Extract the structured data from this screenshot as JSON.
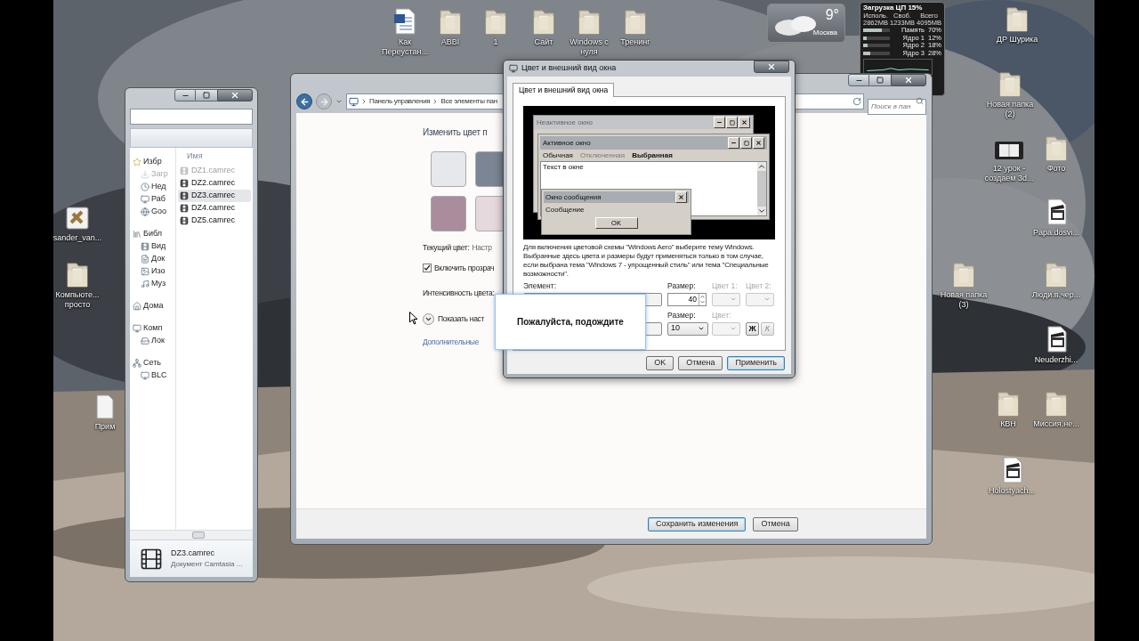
{
  "desktop_icons": [
    {
      "label": "Как Переустан...",
      "kind": "word"
    },
    {
      "label": "ABBI",
      "kind": "folder"
    },
    {
      "label": "1",
      "kind": "folder"
    },
    {
      "label": "Сайт",
      "kind": "folder"
    },
    {
      "label": "Windows с нуля",
      "kind": "folder"
    },
    {
      "label": "Тренинг",
      "kind": "folder"
    },
    {
      "label": "sander_van...",
      "kind": "app"
    },
    {
      "label": "Компьюте... просто",
      "kind": "folder"
    },
    {
      "label": "Прим",
      "kind": "page"
    },
    {
      "label": "ДР Шурика",
      "kind": "folder"
    },
    {
      "label": "Новая папка (2)",
      "kind": "folder"
    },
    {
      "label": "12 урок - создаем 3d...",
      "kind": "tablet"
    },
    {
      "label": "Фото",
      "kind": "folder"
    },
    {
      "label": "Papa.dosvi...",
      "kind": "video"
    },
    {
      "label": "Новая папка (3)",
      "kind": "folder"
    },
    {
      "label": "Люди.в.чер...",
      "kind": "folder"
    },
    {
      "label": "Neuderzhi...",
      "kind": "video"
    },
    {
      "label": "КВН",
      "kind": "folder"
    },
    {
      "label": "Миссия.не...",
      "kind": "folder"
    },
    {
      "label": "Holostyach...",
      "kind": "video"
    }
  ],
  "weather_gadget": {
    "temperature": "9°",
    "city": "Москва"
  },
  "cpu_gadget": {
    "title": "Загрузка ЦП 15%",
    "columns": [
      {
        "label": "Исполь.",
        "value": "2862MB"
      },
      {
        "label": "Своб.",
        "value": "1233MB"
      },
      {
        "label": "Всего",
        "value": "4095MB"
      }
    ],
    "meters": [
      {
        "label": "Память",
        "reading": "70%",
        "level": 0.7
      },
      {
        "label": "Ядро 1",
        "reading": "12%",
        "level": 0.12
      },
      {
        "label": "Ядро 2",
        "reading": "18%",
        "level": 0.18
      },
      {
        "label": "Ядро 3",
        "reading": "28%",
        "level": 0.28
      }
    ]
  },
  "explorer": {
    "nav": [
      {
        "label": "Избр",
        "children": [
          {
            "label": "Загр",
            "dimmed": true
          },
          {
            "label": "Нед",
            "dimmed": false
          },
          {
            "label": "Раб",
            "dimmed": false
          },
          {
            "label": "Goo",
            "dimmed": false
          }
        ]
      },
      {
        "label": "Библ",
        "children": [
          {
            "label": "Вид",
            "dimmed": false
          },
          {
            "label": "Док",
            "dimmed": false
          },
          {
            "label": "Изо",
            "dimmed": false
          },
          {
            "label": "Муз",
            "dimmed": false
          }
        ]
      },
      {
        "label": "Дома"
      },
      {
        "label": "Комп",
        "children": [
          {
            "label": "Лок",
            "dimmed": false
          }
        ]
      },
      {
        "label": "Сеть",
        "children": [
          {
            "label": "BLC",
            "dimmed": false
          }
        ]
      }
    ],
    "column_header": "Имя",
    "files": [
      {
        "name": "DZ1.camrec",
        "selected": false,
        "dimmed": true
      },
      {
        "name": "DZ2.camrec",
        "selected": false,
        "dimmed": false
      },
      {
        "name": "DZ3.camrec",
        "selected": true,
        "dimmed": false
      },
      {
        "name": "DZ4.camrec",
        "selected": false,
        "dimmed": false
      },
      {
        "name": "DZ5.camrec",
        "selected": false,
        "dimmed": false
      }
    ],
    "details": {
      "name": "DZ3.camrec",
      "type": "Документ Camtasia ..."
    }
  },
  "control_panel": {
    "breadcrumbs": [
      "Панель управления",
      "Все элементы пан"
    ],
    "search": {
      "placeholder": "Поиск в пан"
    },
    "heading": "Изменить цвет п",
    "swatches": [
      {
        "color": "#e6e8ec"
      },
      {
        "color": "#7c8594"
      },
      {
        "color": "#a98d9d"
      },
      {
        "color": "#e6d9de"
      }
    ],
    "current_color": {
      "label": "Текущий цвет:",
      "value": "Настр"
    },
    "transparency": {
      "label": "Включить прозрач",
      "checked": true
    },
    "intensity_label": "Интенсивность цвета:",
    "mixer": {
      "label": "Показать наст",
      "expanded": false
    },
    "advanced_link": "Дополнительные",
    "buttons": [
      {
        "label": "Сохранить изменения",
        "default": true
      },
      {
        "label": "Отмена",
        "default": false
      }
    ]
  },
  "dialog": {
    "title": "Цвет и внешний вид окна",
    "tabs": [
      {
        "label": "Цвет и внешний вид окна",
        "selected": true
      }
    ],
    "preview": {
      "inactive_title": "Неактивное окно",
      "active_title": "Активное окно",
      "menu": [
        {
          "label": "Обычная",
          "kind": "normal"
        },
        {
          "label": "Отключенная",
          "kind": "disabled"
        },
        {
          "label": "Выбранная",
          "kind": "selected"
        }
      ],
      "window_text": "Текст в окне",
      "message_title": "Окно сообщения",
      "message_text": "Сообщение",
      "message_button": "OK"
    },
    "description": "Для включения цветовой схемы \"Windows Aero\" выберите тему Windows. Выбранные здесь цвета и размеры будут применяться только в том случае, если выбрана тема \"Windows 7 - упрощенный стиль\" или тема \"Специальные возможности\".",
    "element": {
      "label": "Элемент:"
    },
    "element_size": {
      "label": "Размер:",
      "value": "40"
    },
    "color_1": {
      "label": "Цвет 1:",
      "disabled": true
    },
    "color_2": {
      "label": "Цвет 2:",
      "disabled": true
    },
    "font_size": {
      "label": "Размер:",
      "value": "10"
    },
    "font_color": {
      "label": "Цвет:",
      "disabled": true
    },
    "bold": {
      "label": "Ж",
      "disabled": false
    },
    "italic": {
      "label": "К",
      "disabled": true
    },
    "buttons": [
      {
        "label": "OK",
        "default": false
      },
      {
        "label": "Отмена",
        "default": false
      },
      {
        "label": "Применить",
        "default": true
      }
    ]
  },
  "wait_popup": {
    "text": "Пожалуйста, подождите"
  }
}
